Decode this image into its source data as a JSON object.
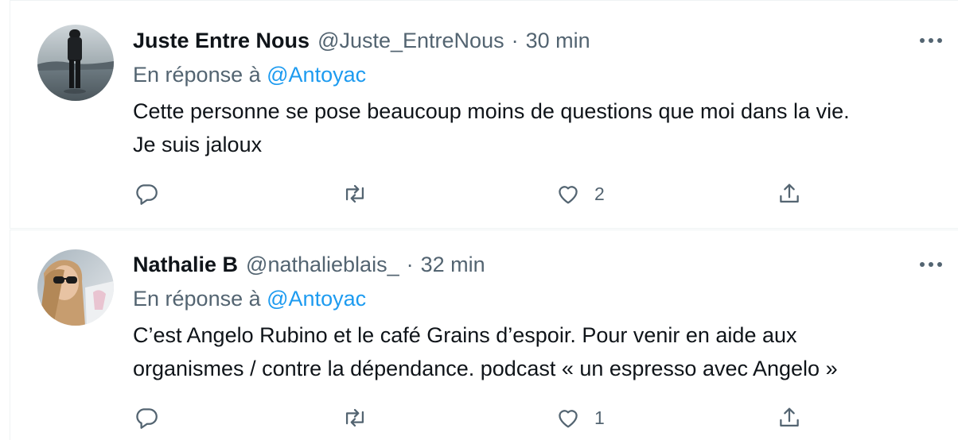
{
  "tweets": [
    {
      "name": "Juste Entre Nous",
      "handle": "@Juste_EntreNous",
      "separator": "·",
      "time": "30 min",
      "reply_prefix": "En réponse à",
      "reply_to": "@Antoyac",
      "text_lines": [
        "Cette personne se pose beaucoup moins de questions que moi dans la vie.",
        "Je suis jaloux"
      ],
      "like_count": "2",
      "avatar_icon": "person-standing-by-lake-avatar"
    },
    {
      "name": "Nathalie B",
      "handle": "@nathalieblais_",
      "separator": "·",
      "time": "32 min",
      "reply_prefix": "En réponse à",
      "reply_to": "@Antoyac",
      "text_lines": [
        "C’est Angelo Rubino et le café Grains d’espoir. Pour venir en aide aux",
        "organismes / contre la dépendance. podcast « un espresso avec Angelo »"
      ],
      "like_count": "1",
      "avatar_icon": "woman-with-sunglasses-avatar"
    }
  ],
  "icons": {
    "more": "more-horizontal-icon",
    "reply": "reply-bubble-icon",
    "retweet": "retweet-icon",
    "like": "heart-icon",
    "share": "share-icon"
  },
  "colors": {
    "text_primary": "#0f1419",
    "text_secondary": "#536471",
    "mention": "#1d9bf0",
    "divider": "#eff3f4"
  }
}
